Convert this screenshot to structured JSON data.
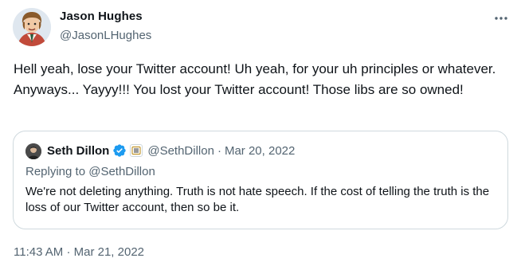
{
  "tweet": {
    "author": {
      "name": "Jason Hughes",
      "handle": "@JasonLHughes"
    },
    "text": "Hell yeah, lose your Twitter account! Uh yeah, for your uh principles or whatever. Anyways... Yayyy!!! You lost your Twitter account! Those libs are so owned!",
    "time": "11:43 AM",
    "separator": "·",
    "date": "Mar 21, 2022",
    "more_icon": "more-horizontal-icon"
  },
  "quote": {
    "author": {
      "name": "Seth Dillon",
      "handle": "@SethDillon"
    },
    "separator": "·",
    "date": "Mar 20, 2022",
    "reply_context": "Replying to @SethDillon",
    "text": "We're not deleting anything. Truth is not hate speech. If the cost of telling the truth is the loss of our Twitter account, then so be it.",
    "verified_icon": "verified-badge-icon",
    "affiliate_icon": "affiliate-badge-icon"
  },
  "colors": {
    "primary_text": "#0f1419",
    "secondary_text": "#536471",
    "border": "#cfd9de",
    "verified_blue": "#1d9bf0"
  }
}
